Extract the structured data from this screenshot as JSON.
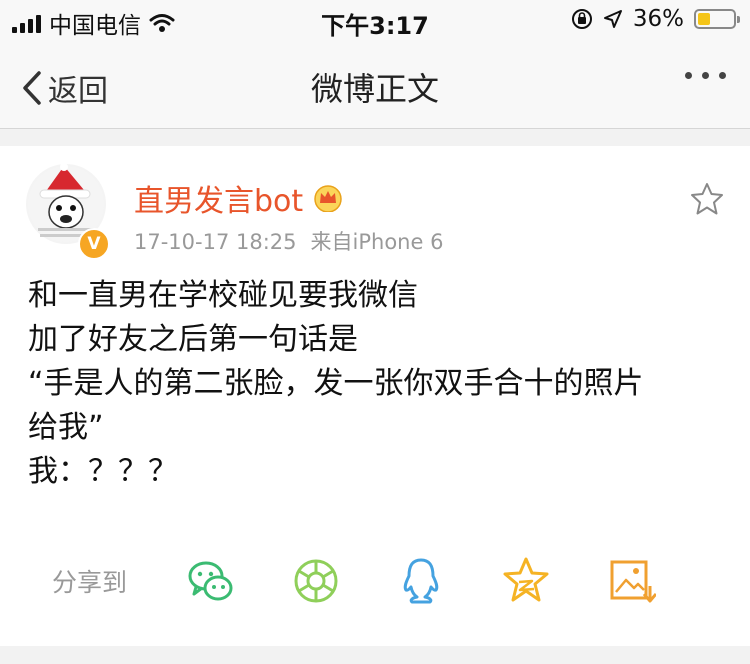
{
  "status": {
    "carrier": "中国电信",
    "time": "下午3:17",
    "battery_percent": "36%",
    "battery_level": 0.36,
    "battery_color": "#f5c518"
  },
  "nav": {
    "back_label": "返回",
    "title": "微博正文"
  },
  "post": {
    "author": "直男发言bot",
    "verified_badge": "V",
    "date": "17-10-17 18:25",
    "source": "来自iPhone 6",
    "lines": [
      "和一直男在学校碰见要我微信",
      "加了好友之后第一句话是",
      "“手是人的第二张脸，发一张你双手合十的照片",
      "给我”",
      "我：？？？"
    ]
  },
  "share": {
    "label": "分享到",
    "targets": [
      "wechat-icon",
      "moments-icon",
      "qq-icon",
      "qzone-icon",
      "save-image-icon"
    ]
  },
  "colors": {
    "author": "#e8552b",
    "wechat": "#3bbb72",
    "moments": "#8fcf5a",
    "qq": "#45a2e0",
    "qzone": "#f5b324",
    "save": "#f0a030"
  }
}
